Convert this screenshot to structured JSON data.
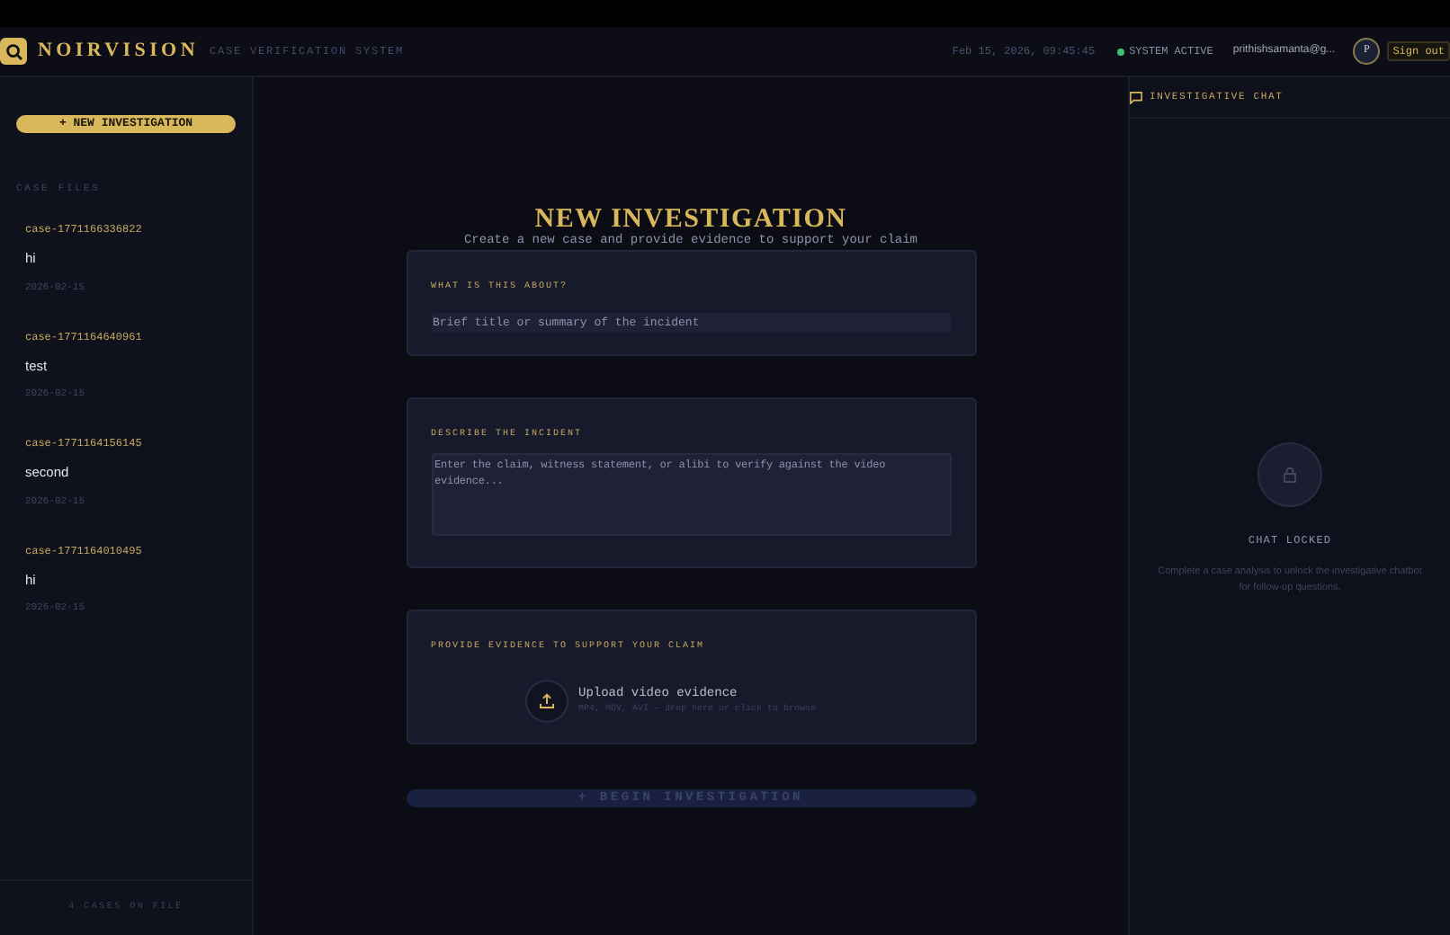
{
  "header": {
    "logo": "NOIRVISION",
    "subtitle": "CASE VERIFICATION SYSTEM",
    "datetime": "Feb 15, 2026, 09:45:45",
    "status": "SYSTEM ACTIVE",
    "status_active": true,
    "user": "prithishsamanta@g...",
    "avatar": "P",
    "sign_out": "Sign out"
  },
  "sidebar": {
    "new_button": "+ NEW INVESTIGATION",
    "section": "CASE FILES",
    "cases": [
      {
        "id": "case-1771166336822",
        "title": "hi",
        "date": "2026-02-15",
        "selected": false
      },
      {
        "id": "case-1771164640961",
        "title": "test",
        "date": "2026-02-15",
        "selected": false
      },
      {
        "id": "case-1771164156145",
        "title": "second",
        "date": "2026-02-15",
        "selected": false
      },
      {
        "id": "case-1771164010495",
        "title": "hi",
        "date": "2026-02-15",
        "selected": false
      }
    ],
    "footer": "4 CASES ON FILE"
  },
  "main": {
    "title": "NEW INVESTIGATION",
    "subtitle": "Create a new case and provide evidence to support your claim",
    "title_field": {
      "label": "WHAT IS THIS ABOUT?",
      "placeholder": "Brief title or summary of the incident"
    },
    "description_field": {
      "label": "DESCRIBE THE INCIDENT",
      "placeholder": "Enter the claim, witness statement, or alibi to verify against the video evidence..."
    },
    "evidence": {
      "label": "PROVIDE EVIDENCE TO SUPPORT YOUR CLAIM",
      "upload_title": "Upload video evidence",
      "upload_hint": "MP4, MOV, AVI — drop here or click to browse"
    },
    "begin_button": {
      "label": "+ BEGIN INVESTIGATION",
      "disabled": true
    }
  },
  "chat": {
    "title": "INVESTIGATIVE CHAT",
    "locked": true,
    "locked_title": "CHAT LOCKED",
    "locked_text": "Complete a case analysis to unlock the investigative chatbot for follow-up questions."
  }
}
